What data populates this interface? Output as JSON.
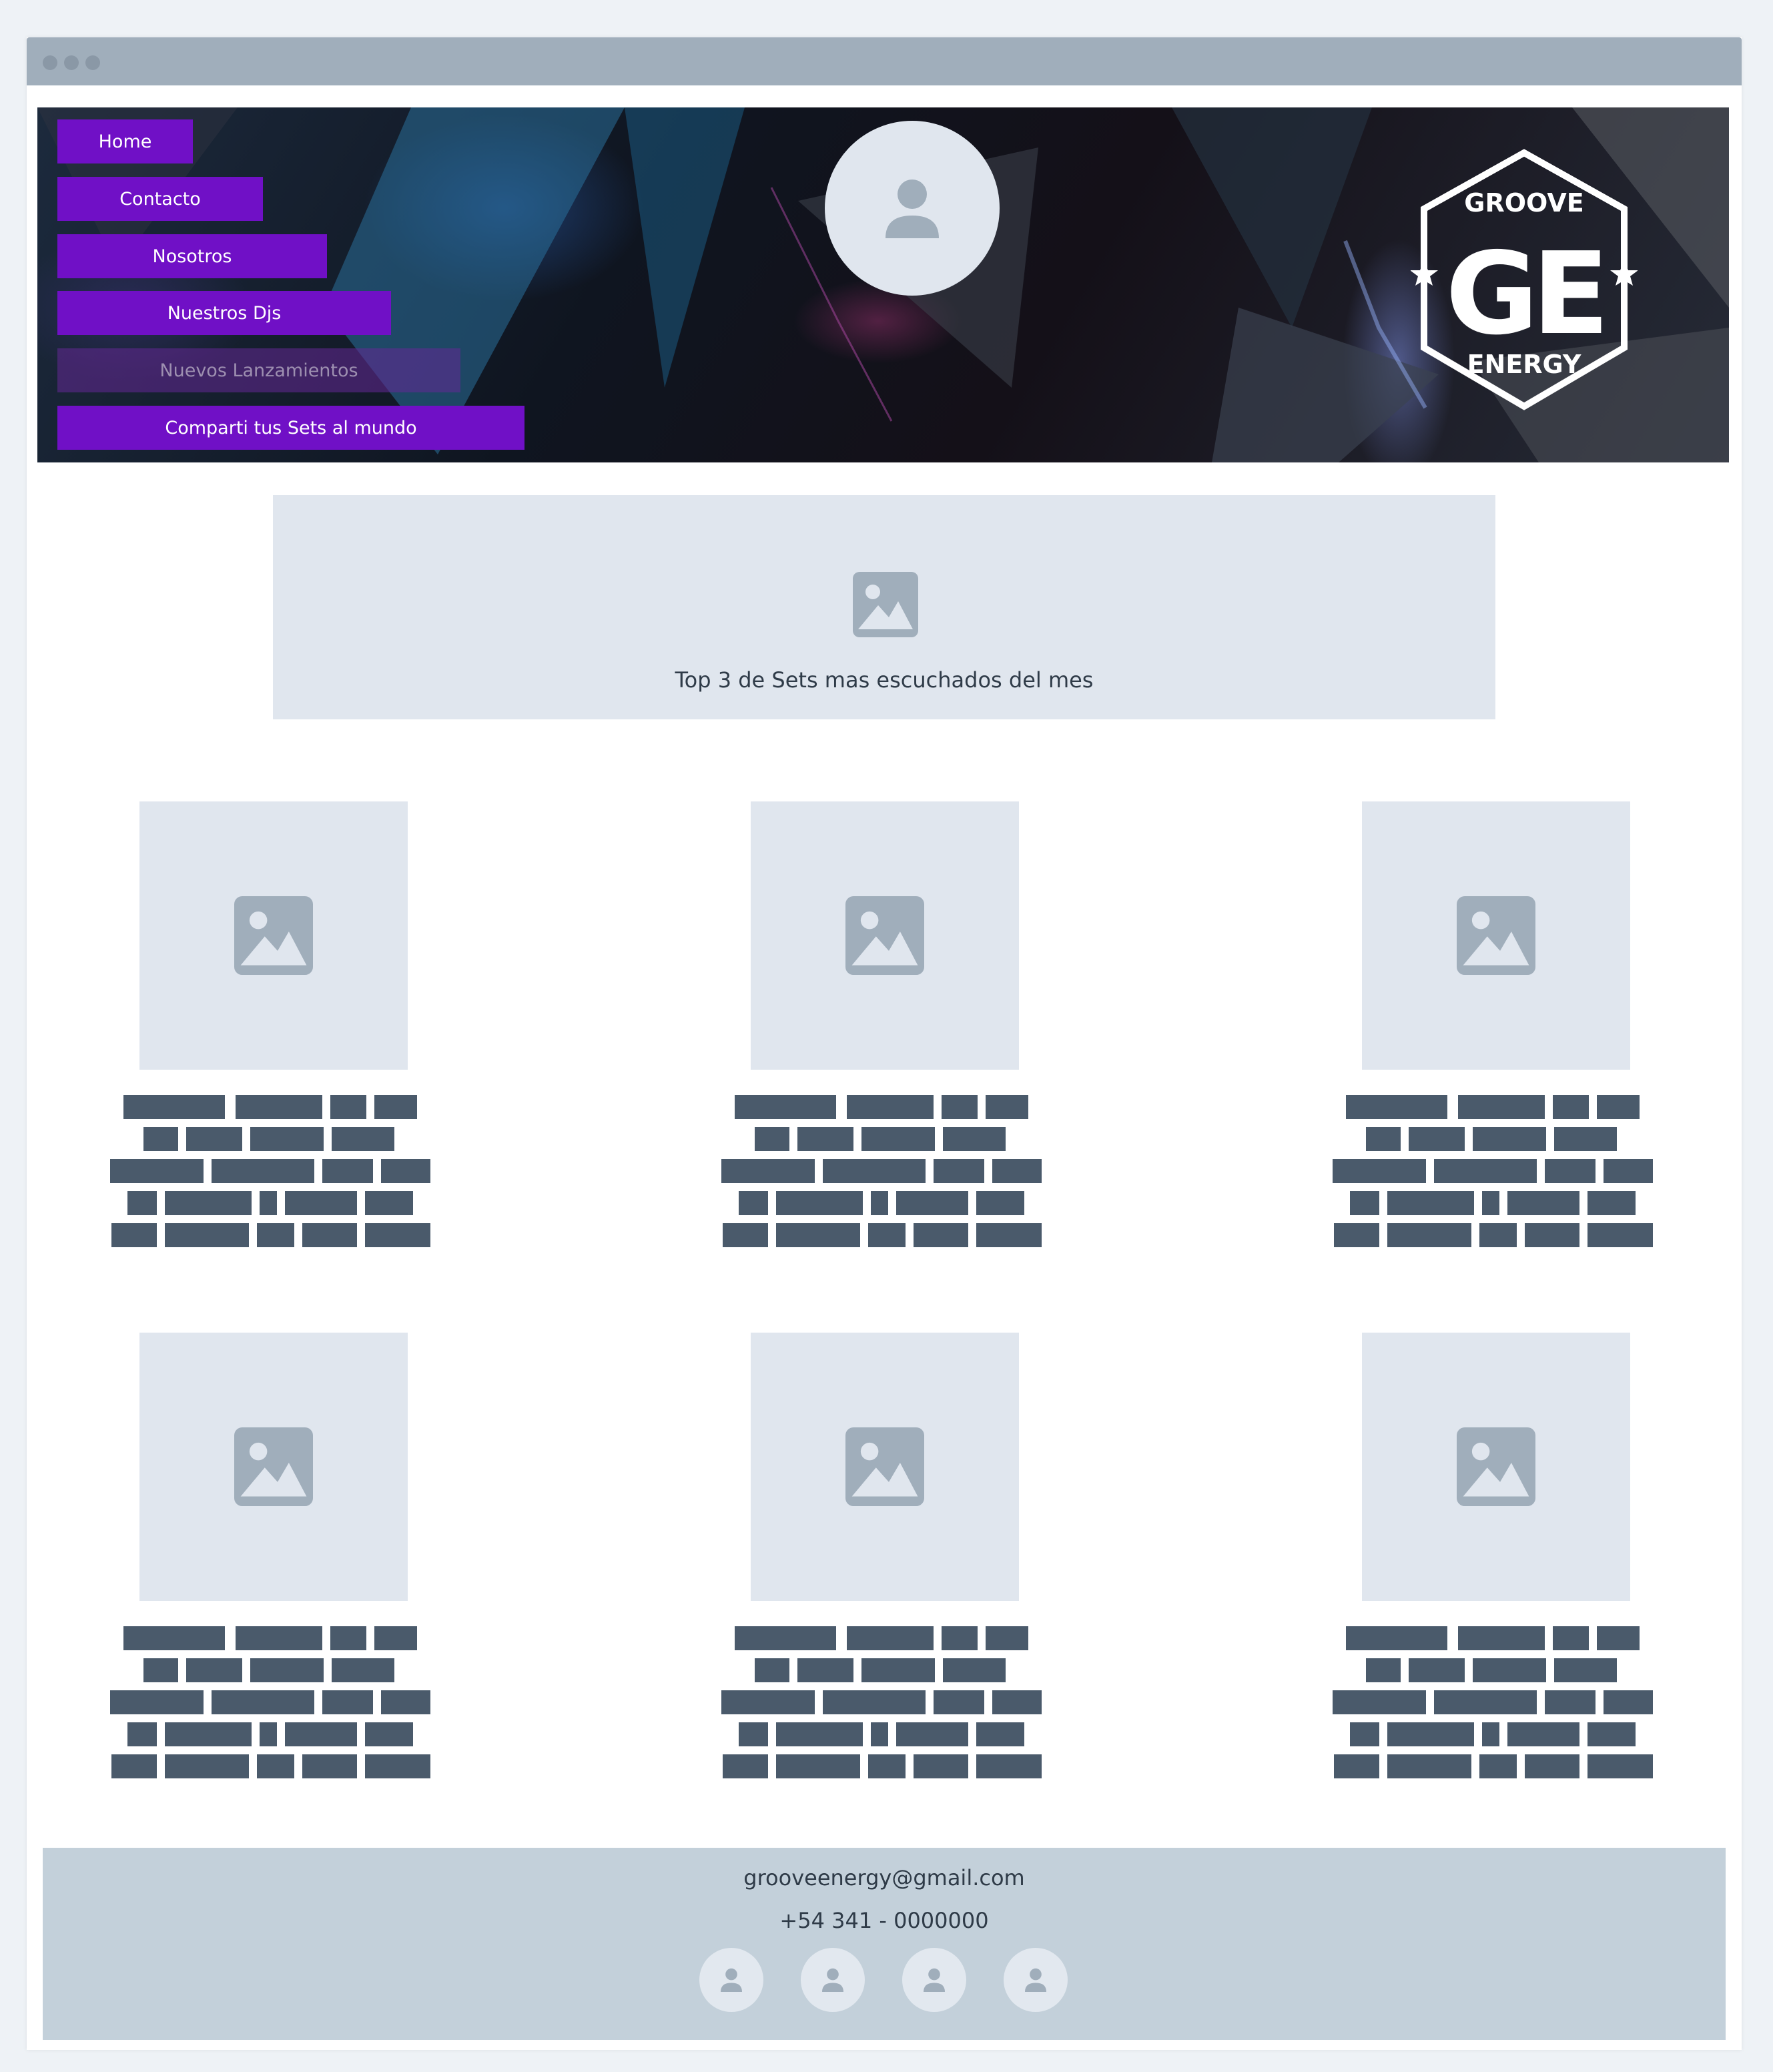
{
  "nav": {
    "home": "Home",
    "contacto": "Contacto",
    "nosotros": "Nosotros",
    "djs": "Nuestros Djs",
    "lanzamientos": "Nuevos Lanzamientos",
    "sets": "Comparti tus Sets al mundo"
  },
  "hero": {
    "logo_top": "GROOVE",
    "logo_letters": "GE",
    "logo_bottom": "ENERGY"
  },
  "banner": {
    "text": "Top 3 de Sets mas escuchados del mes"
  },
  "footer": {
    "email": "grooveenergy@gmail.com",
    "phone": "+54 341 - 0000000"
  },
  "colors": {
    "nav_button": "#7010c6",
    "placeholder": "#e0e6ee",
    "text_block": "#4a5a6b",
    "footer_bg": "#c3d0da"
  },
  "icons": [
    "person-icon",
    "image-icon",
    "star-icon"
  ]
}
